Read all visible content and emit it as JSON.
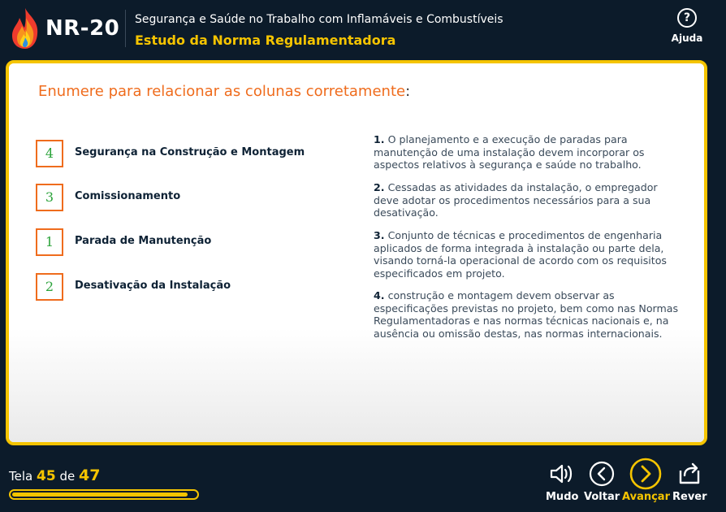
{
  "header": {
    "logo_text": "NR-20",
    "title": "Segurança e Saúde no Trabalho com Inflamáveis e Combustíveis",
    "subtitle": "Estudo da Norma Regulamentadora",
    "help_label": "Ajuda",
    "help_icon": "question-circle-icon"
  },
  "content": {
    "heading": "Enumere para relacionar as colunas corretamente",
    "heading_suffix": ":",
    "left_items": [
      {
        "answer": "4",
        "label": "Segurança na Construção e Montagem"
      },
      {
        "answer": "3",
        "label": "Comissionamento"
      },
      {
        "answer": "1",
        "label": "Parada de Manutenção"
      },
      {
        "answer": "2",
        "label": "Desativação da Instalação"
      }
    ],
    "right_items": [
      {
        "num": "1.",
        "text": "O planejamento e a execução de paradas para manutenção de uma instalação devem incorporar os aspectos relativos à segurança e saúde no trabalho."
      },
      {
        "num": "2.",
        "text": "Cessadas as atividades da instalação, o empregador deve adotar os procedimentos necessários para a sua desativação."
      },
      {
        "num": "3.",
        "text": "Conjunto de técnicas e procedimentos de engenharia aplicados de forma integrada à instalação ou parte dela, visando torná-la operacional de acordo com os requisitos especificados em projeto."
      },
      {
        "num": "4.",
        "text": "construção e montagem devem observar as especificações previstas no projeto, bem como nas Normas Regulamentadoras e nas normas técnicas nacionais e, na ausência ou omissão destas, nas normas internacionais."
      }
    ]
  },
  "footer": {
    "screen_label": "Tela",
    "current": "45",
    "of_label": "de",
    "total": "47",
    "progress_fraction": 0.957,
    "controls": {
      "mute": "Mudo",
      "back": "Voltar",
      "next": "Avançar",
      "replay": "Rever"
    }
  },
  "colors": {
    "background": "#0c1b2a",
    "accent": "#f5c400",
    "heading": "#ef6c1d",
    "answer": "#2ba33a"
  }
}
